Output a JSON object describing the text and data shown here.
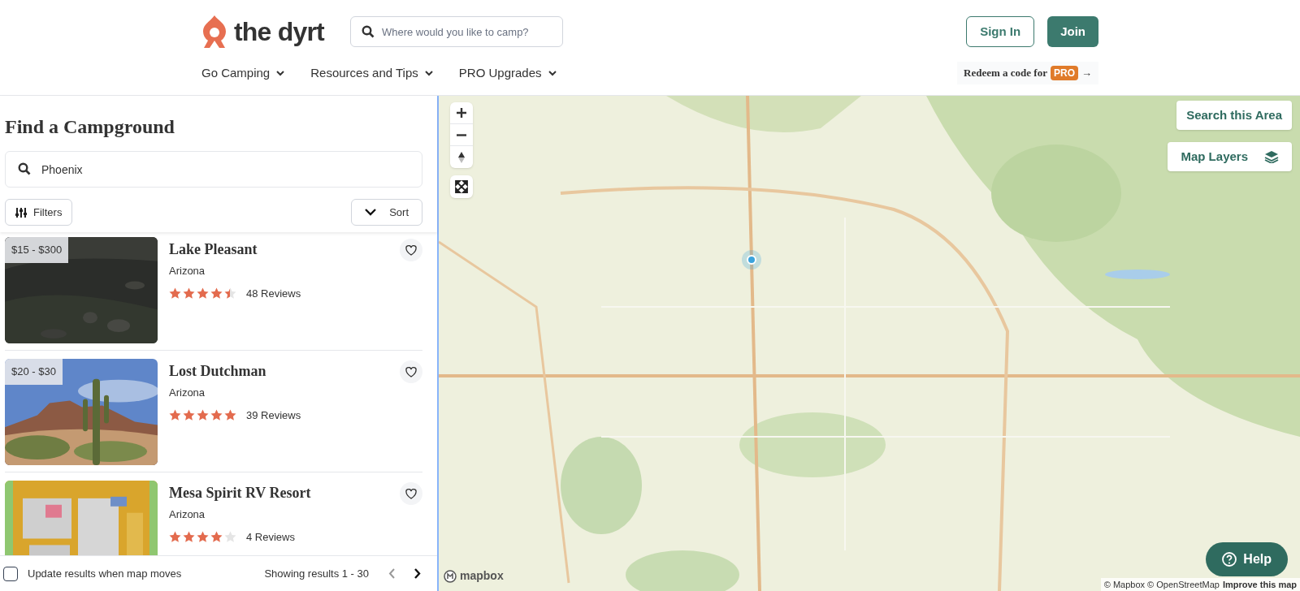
{
  "header": {
    "logo": "the dyrt",
    "search": {
      "placeholder": "Where would you like to camp?"
    },
    "buttons": [
      {
        "label": "Sign In",
        "kind": "outline"
      },
      {
        "label": "Join",
        "kind": "solid"
      }
    ],
    "nav": [
      {
        "label": "Go Camping"
      },
      {
        "label": "Resources and Tips"
      },
      {
        "label": "PRO Upgrades"
      }
    ],
    "redeem": {
      "text": "Redeem a code for",
      "badge": "PRO",
      "arrow": "→"
    }
  },
  "sidebar": {
    "title": "Find a Campground",
    "search": {
      "value": "Phoenix"
    },
    "filters": "Filters",
    "sort": "Sort",
    "results": [
      {
        "name": "Lake Pleasant",
        "price": "$15 - $300",
        "region": "Arizona",
        "stars": 4.5,
        "reviews": "48 Reviews",
        "kind": "picture"
      },
      {
        "name": "Lost Dutchman",
        "price": "$20 - $30",
        "region": "Arizona",
        "stars": 5,
        "reviews": "39 Reviews",
        "kind": "picture"
      },
      {
        "name": "Mesa Spirit RV Resort",
        "region": "Arizona",
        "stars": 4,
        "reviews": "4 Reviews",
        "kind": "picture"
      }
    ],
    "footer": {
      "update": {
        "label": "Update results when map moves",
        "checked": false
      },
      "showing": "Showing results 1 - 30"
    }
  },
  "map": {
    "search_area": "Search this Area",
    "layers": "Map Layers",
    "help": "Help",
    "brand": "mapbox",
    "attribution": "© Mapbox © OpenStreetMap",
    "improve": "Improve this map"
  }
}
